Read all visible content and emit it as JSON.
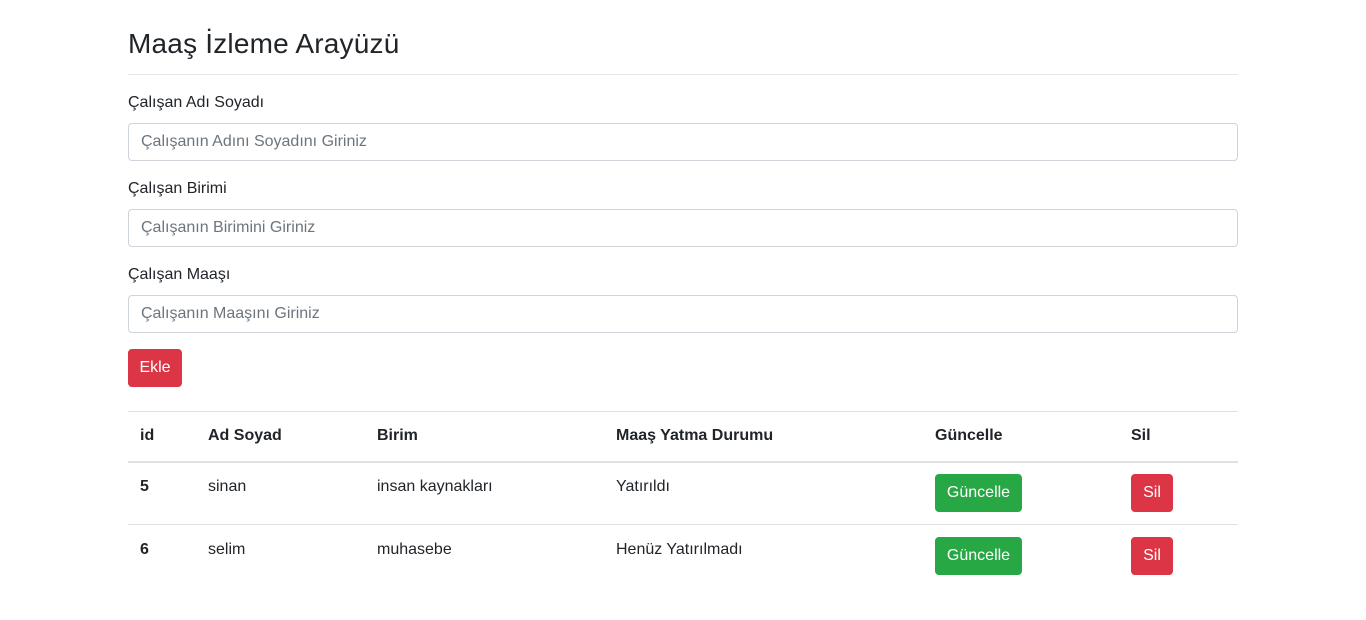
{
  "page": {
    "title": "Maaş İzleme Arayüzü"
  },
  "form": {
    "name_label": "Çalışan Adı Soyadı",
    "name_placeholder": "Çalışanın Adını Soyadını Giriniz",
    "unit_label": "Çalışan Birimi",
    "unit_placeholder": "Çalışanın Birimini Giriniz",
    "salary_label": "Çalışan Maaşı",
    "salary_placeholder": "Çalışanın Maaşını Giriniz",
    "add_button": "Ekle"
  },
  "table": {
    "headers": {
      "id": "id",
      "name": "Ad Soyad",
      "unit": "Birim",
      "status": "Maaş Yatma Durumu",
      "update": "Güncelle",
      "delete": "Sil"
    },
    "rows": [
      {
        "id": "5",
        "name": "sinan",
        "unit": "insan kaynakları",
        "status": "Yatırıldı",
        "update_label": "Güncelle",
        "delete_label": "Sil"
      },
      {
        "id": "6",
        "name": "selim",
        "unit": "muhasebe",
        "status": "Henüz Yatırılmadı",
        "update_label": "Güncelle",
        "delete_label": "Sil"
      }
    ]
  },
  "colors": {
    "danger": "#dc3545",
    "success": "#28a745"
  }
}
